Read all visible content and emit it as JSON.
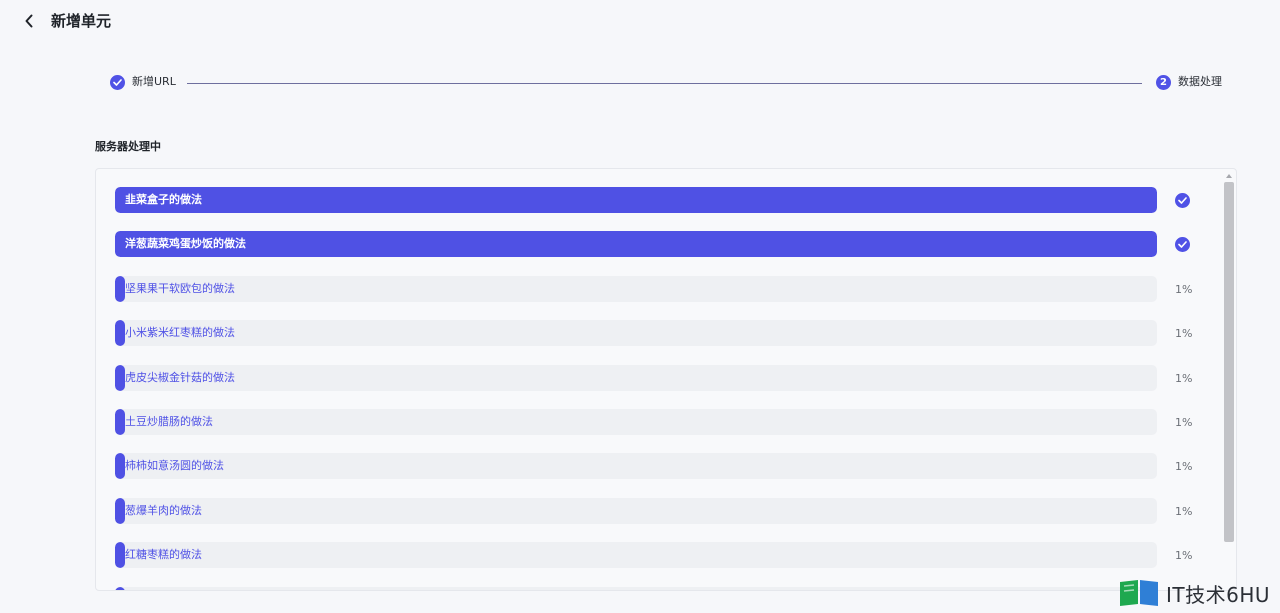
{
  "header": {
    "title": "新增单元",
    "back_icon": "chevron-left-icon"
  },
  "steps": [
    {
      "label": "新增URL",
      "state": "completed",
      "marker": ""
    },
    {
      "label": "数据处理",
      "state": "active",
      "marker": "2"
    }
  ],
  "section": {
    "title": "服务器处理中"
  },
  "tasks": [
    {
      "label": "韭菜盒子的做法",
      "progress": 1.0,
      "done": true,
      "status": ""
    },
    {
      "label": "洋葱蔬菜鸡蛋炒饭的做法",
      "progress": 1.0,
      "done": true,
      "status": ""
    },
    {
      "label": "坚果果干软欧包的做法",
      "progress": 0.01,
      "done": false,
      "status": "1%"
    },
    {
      "label": "小米紫米红枣糕的做法",
      "progress": 0.01,
      "done": false,
      "status": "1%"
    },
    {
      "label": "虎皮尖椒金针菇的做法",
      "progress": 0.01,
      "done": false,
      "status": "1%"
    },
    {
      "label": "土豆炒腊肠的做法",
      "progress": 0.01,
      "done": false,
      "status": "1%"
    },
    {
      "label": "柿柿如意汤圆的做法",
      "progress": 0.01,
      "done": false,
      "status": "1%"
    },
    {
      "label": "葱爆羊肉的做法",
      "progress": 0.01,
      "done": false,
      "status": "1%"
    },
    {
      "label": "红糖枣糕的做法",
      "progress": 0.01,
      "done": false,
      "status": "1%"
    },
    {
      "label": "",
      "progress": 0.01,
      "done": false,
      "status": ""
    }
  ],
  "colors": {
    "accent": "#4f51e4",
    "track": "#eef0f3",
    "background": "#f6f7fa"
  },
  "watermark": {
    "text": "IT技术6HU"
  }
}
